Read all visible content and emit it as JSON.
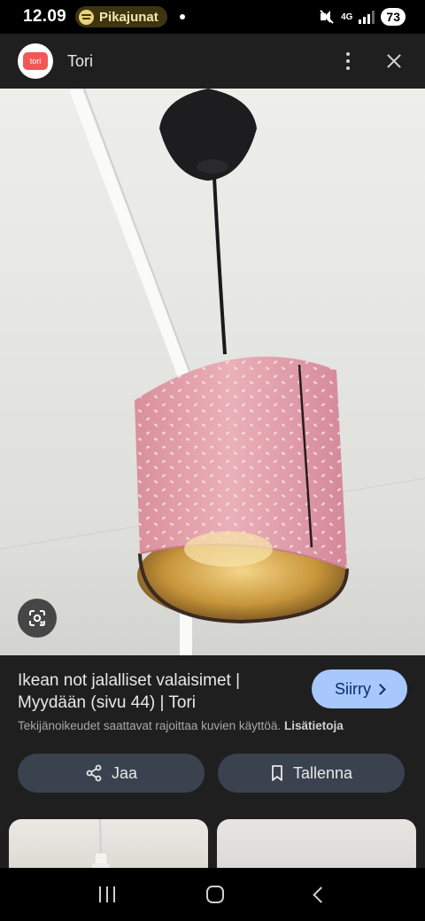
{
  "status_bar": {
    "time": "12.09",
    "media_app": "Pikajunat",
    "network": "4G",
    "battery": "73",
    "icons": [
      "spotify-icon",
      "mute-icon",
      "signal-icon"
    ]
  },
  "header": {
    "site_logo_text": "tori",
    "site_name": "Tori",
    "icons": [
      "more-vert-icon",
      "close-icon"
    ]
  },
  "image": {
    "description_icon": "google-lens-icon"
  },
  "result": {
    "title": "Ikean not jalalliset valaisimet | Myydään (sivu 44) | Tori",
    "visit_label": "Siirry",
    "copyright_text": "Tekijänoikeudet saattavat rajoittaa kuvien käyttöä.",
    "more_info_label": "Lisätietoja",
    "share_label": "Jaa",
    "save_label": "Tallenna"
  },
  "navigation": {
    "icons": [
      "recent-apps-icon",
      "home-icon",
      "back-icon"
    ]
  },
  "colors": {
    "panel_bg": "#1f1f1f",
    "visit_button": "#a8c7fa",
    "action_button": "#3a4250",
    "logo_red": "#f25757",
    "lamp_pink": "#e3a2ab"
  }
}
